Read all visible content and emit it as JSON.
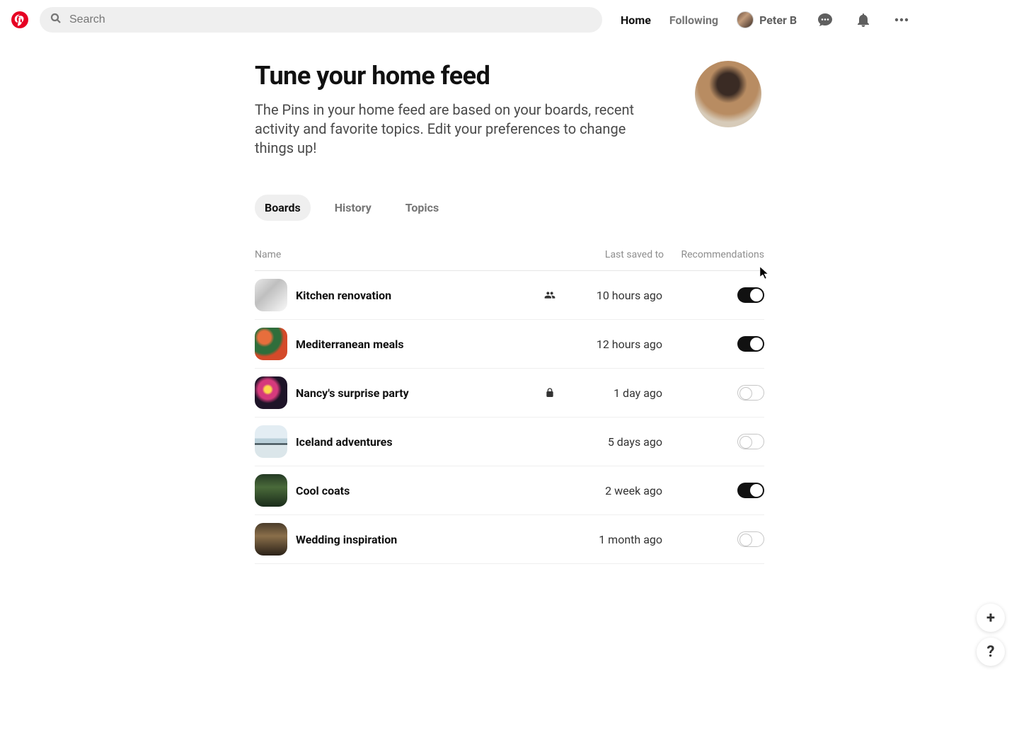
{
  "header": {
    "search_placeholder": "Search",
    "nav": {
      "home": "Home",
      "following": "Following"
    },
    "profile_name": "Peter B"
  },
  "page": {
    "title": "Tune your home feed",
    "subtitle": "The Pins in your home feed are based on your boards, recent activity and favorite topics. Edit your preferences to change things up!"
  },
  "tabs": [
    "Boards",
    "History",
    "Topics"
  ],
  "active_tab": 0,
  "columns": {
    "name": "Name",
    "last": "Last saved to",
    "rec": "Recommendations"
  },
  "boards": [
    {
      "name": "Kitchen renovation",
      "icon": "shared",
      "last": "10 hours ago",
      "on": true
    },
    {
      "name": "Mediterranean meals",
      "icon": "",
      "last": "12 hours ago",
      "on": true
    },
    {
      "name": "Nancy's surprise party",
      "icon": "lock",
      "last": "1 day ago",
      "on": false
    },
    {
      "name": "Iceland adventures",
      "icon": "",
      "last": "5 days ago",
      "on": false
    },
    {
      "name": "Cool coats",
      "icon": "",
      "last": "2 week ago",
      "on": true
    },
    {
      "name": "Wedding inspiration",
      "icon": "",
      "last": "1 month ago",
      "on": false
    }
  ],
  "fab": {
    "plus": "+",
    "help": "?"
  }
}
